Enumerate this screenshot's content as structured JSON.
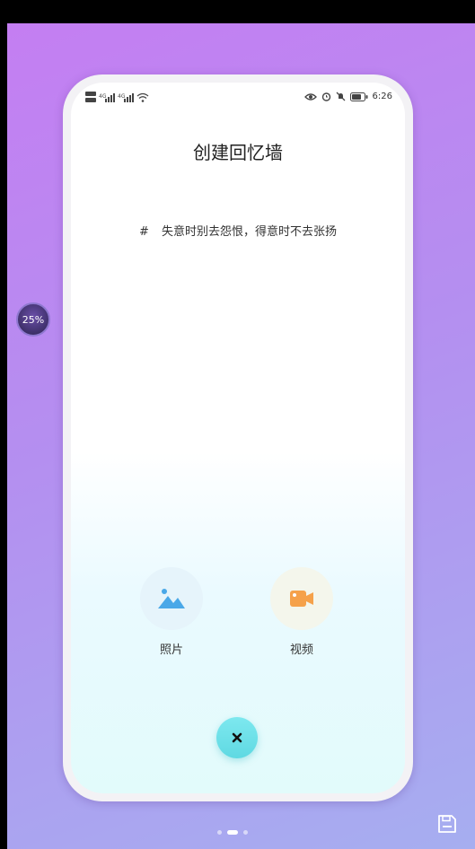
{
  "status_bar": {
    "time": "6:26"
  },
  "page": {
    "title": "创建回忆墙",
    "quote_hash": "#",
    "quote": "失意时别去怨恨，得意时不去张扬"
  },
  "options": [
    {
      "label": "照片",
      "icon": "image-icon",
      "bg": "#e6f4fb",
      "color": "#4aa8e8"
    },
    {
      "label": "视频",
      "icon": "video-camera-icon",
      "bg": "#f4f6ec",
      "color": "#f5a14a"
    }
  ],
  "close_label": "×",
  "overlay": {
    "progress": "25%"
  },
  "pager": {
    "count": 3,
    "active": 1
  }
}
